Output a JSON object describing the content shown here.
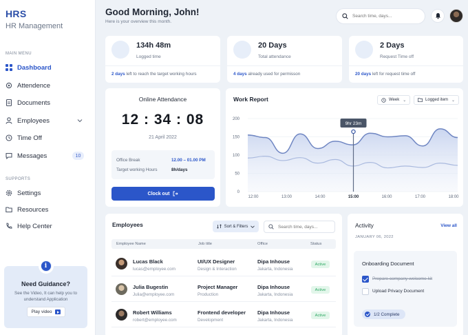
{
  "sidebar": {
    "brand": "HRS",
    "brand_sub": "HR Management",
    "main_menu_label": "MAIN MENU",
    "items": [
      {
        "label": "Dashboard",
        "icon": "grid-icon",
        "active": true
      },
      {
        "label": "Attendence",
        "icon": "gear-icon"
      },
      {
        "label": "Documents",
        "icon": "document-icon"
      },
      {
        "label": "Employees",
        "icon": "user-icon"
      },
      {
        "label": "Time Off",
        "icon": "clock-icon"
      },
      {
        "label": "Messages",
        "icon": "message-icon",
        "badge": "10"
      }
    ],
    "supports_label": "SUPPORTS",
    "support_items": [
      {
        "label": "Settings",
        "icon": "settings-icon"
      },
      {
        "label": "Resources",
        "icon": "folder-icon"
      },
      {
        "label": "Help Center",
        "icon": "phone-icon"
      }
    ],
    "guide": {
      "title": "Need Guidance?",
      "desc": "See the Video, It can help you to understand Application",
      "button": "Play video"
    }
  },
  "header": {
    "greeting": "Good Morning, John!",
    "subtitle": "Here is your overview this month.",
    "search_placeholder": "Search time, days..."
  },
  "stats": [
    {
      "value": "134h 48m",
      "label": "Logged time",
      "foot_highlight": "2 days",
      "foot_text": " left to reach the target working hours"
    },
    {
      "value": "20 Days",
      "label": "Total attendance",
      "foot_highlight": "4 days",
      "foot_text": " already used for permisson"
    },
    {
      "value": "2 Days",
      "label": "Request Time off",
      "foot_highlight": "20 days",
      "foot_text": " left for request time off"
    }
  ],
  "attendance": {
    "title": "Online Attendance",
    "clock": "12 : 34 : 08",
    "date": "21 April 2022",
    "office_break_label": "Office Break",
    "office_break_value": "12.00 – 01.00 PM",
    "target_label": "Target working Hours",
    "target_value": "8h/days",
    "button": "Clock out"
  },
  "report": {
    "title": "Work Report",
    "period": "Week",
    "filter": "Logged item",
    "tooltip": "9hr 23m"
  },
  "chart_data": {
    "type": "area",
    "x": [
      "12:00",
      "13:00",
      "14:00",
      "15:00",
      "16:00",
      "17:00",
      "18:00"
    ],
    "ylim": [
      0,
      200
    ],
    "yticks": [
      0,
      50,
      100,
      150,
      200
    ],
    "highlight_x": "15:00",
    "series": [
      {
        "values": [
          155,
          148,
          105,
          158,
          118,
          138,
          128,
          160,
          150,
          153,
          125,
          172,
          148
        ]
      },
      {
        "values": [
          92,
          97,
          85,
          93,
          78,
          88,
          70,
          80,
          65,
          70,
          66,
          78,
          72
        ]
      }
    ]
  },
  "employees": {
    "title": "Employees",
    "sort_label": "Sort & Filters",
    "search_placeholder": "Search time, days...",
    "columns": [
      "Employee Name",
      "Job title",
      "Office",
      "Status"
    ],
    "rows": [
      {
        "name": "Lucas Black",
        "email": "lucas@employee.com",
        "job": "UI/UX Designer",
        "dept": "Design & Interaction",
        "office": "Dipa Inhouse",
        "loc": "Jakarta, Indonesia",
        "status": "Active"
      },
      {
        "name": "Julia Bugestin",
        "email": "Julia@employee.com",
        "job": "Project Manager",
        "dept": "Production",
        "office": "Dipa Inhouse",
        "loc": "Jakarta, Indonesia",
        "status": "Active"
      },
      {
        "name": "Robert Williams",
        "email": "robert@employee.com",
        "job": "Frontend developer",
        "dept": "Development",
        "office": "Dipa Inhouse",
        "loc": "Jakarta, Indonesia",
        "status": "Active"
      }
    ]
  },
  "activity": {
    "title": "Activity",
    "view_all": "View all",
    "date": "JANUARY 06, 2022",
    "card_title": "Onboarding Document",
    "tasks": [
      {
        "label": "Prepare company welcome kit",
        "done": true
      },
      {
        "label": "Upload Privacy Document",
        "done": false
      }
    ],
    "progress": "1/2 Complete"
  },
  "colors": {
    "accent": "#2b56c9",
    "active_green": "#2fa864",
    "bg": "#eef2f7"
  }
}
